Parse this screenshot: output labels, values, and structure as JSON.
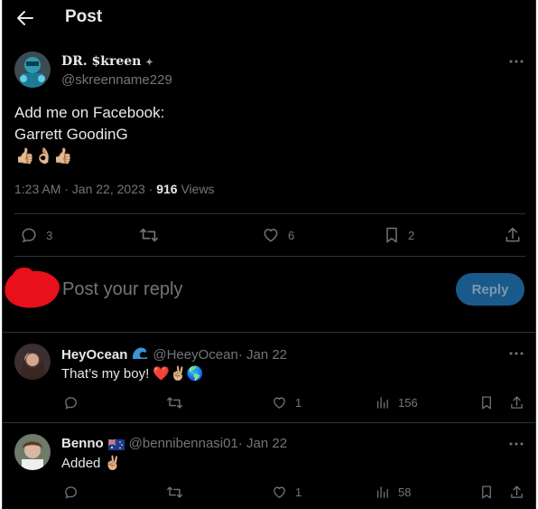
{
  "header": {
    "title": "Post"
  },
  "post": {
    "display_name": "DR. $kreen",
    "handle": "@skreenname229",
    "text_line1": "Add me on Facebook:",
    "text_line2": "Garrett GoodinG",
    "emojis": "👍🏼👌🏼👍🏼",
    "time": "1:23 AM · Jan 22, 2023 · ",
    "views_count": "916",
    "views_label": " Views",
    "replies": "3",
    "likes": "6",
    "bookmarks": "2"
  },
  "composer": {
    "placeholder": "Post your reply",
    "button_label": "Reply"
  },
  "replies": [
    {
      "name": "HeyOcean",
      "handle": "@HeeyOcean",
      "date": " · Jan 22",
      "text": "That’s my boy! ❤️✌🏼🌎",
      "likes": "1",
      "views": "156"
    },
    {
      "name": "Benno",
      "handle": "@bennibennasi01",
      "date": " · Jan 22",
      "text": "Added ✌🏼",
      "likes": "1",
      "views": "58"
    }
  ],
  "colors": {
    "background": "#000000",
    "text": "#e7e9ea",
    "muted": "#71767b",
    "divider": "#2f3336",
    "reply_button": "#1a5a8b"
  }
}
